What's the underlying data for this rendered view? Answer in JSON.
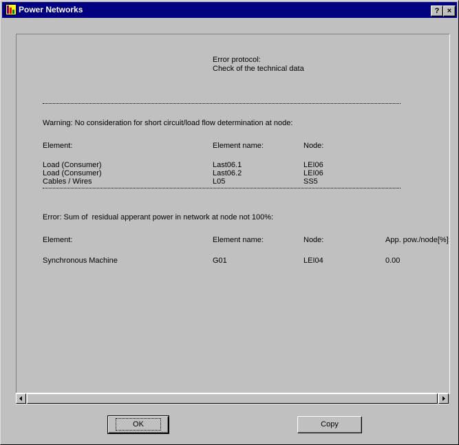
{
  "window": {
    "title": "Power Networks",
    "help_label": "?",
    "close_label": "×"
  },
  "protocol": {
    "header_line1": "Error protocol:",
    "header_line2": "Check of the technical data",
    "warning": {
      "message": "Warning: No consideration for short circuit/load flow determination at node:",
      "columns": [
        "Element:",
        "Element name:",
        "Node:"
      ],
      "rows": [
        [
          "Load (Consumer)",
          "Last06.1",
          "LEI06"
        ],
        [
          "Load (Consumer)",
          "Last06.2",
          "LEI06"
        ],
        [
          "Cables / Wires",
          "L05",
          "SS5"
        ]
      ]
    },
    "error": {
      "message": "Error: Sum of  residual apperant power in network at node not 100%:",
      "columns": [
        "Element:",
        "Element name:",
        "Node:",
        "App. pow./node[%]:"
      ],
      "rows": [
        [
          "Synchronous Machine",
          "G01",
          "LEI04",
          "0.00"
        ]
      ]
    }
  },
  "buttons": {
    "ok": "OK",
    "copy": "Copy"
  }
}
